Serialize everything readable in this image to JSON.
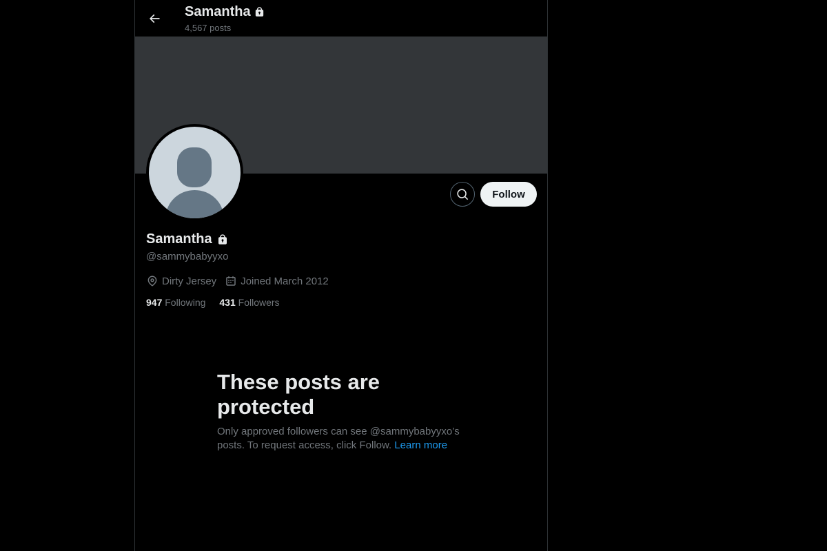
{
  "header": {
    "title": "Samantha",
    "post_count": "4,567 posts"
  },
  "profile": {
    "display_name": "Samantha",
    "handle": "@sammybabyyxo",
    "location": "Dirty Jersey",
    "joined": "Joined March 2012",
    "following_count": "947",
    "following_label": "Following",
    "followers_count": "431",
    "followers_label": "Followers"
  },
  "actions": {
    "follow_label": "Follow"
  },
  "protected_notice": {
    "title": "These posts are protected",
    "body": "Only approved followers can see @sammybabyyxo’s posts. To request access, click Follow.",
    "link": "Learn more"
  },
  "icons": [
    "back-arrow-icon",
    "lock-icon",
    "search-icon",
    "location-pin-icon",
    "calendar-icon"
  ],
  "colors": {
    "background": "#000000",
    "banner": "#333639",
    "text_primary": "#e7e9ea",
    "text_secondary": "#71767b",
    "link": "#1d9bf0",
    "follow_button_bg": "#eff3f4"
  }
}
